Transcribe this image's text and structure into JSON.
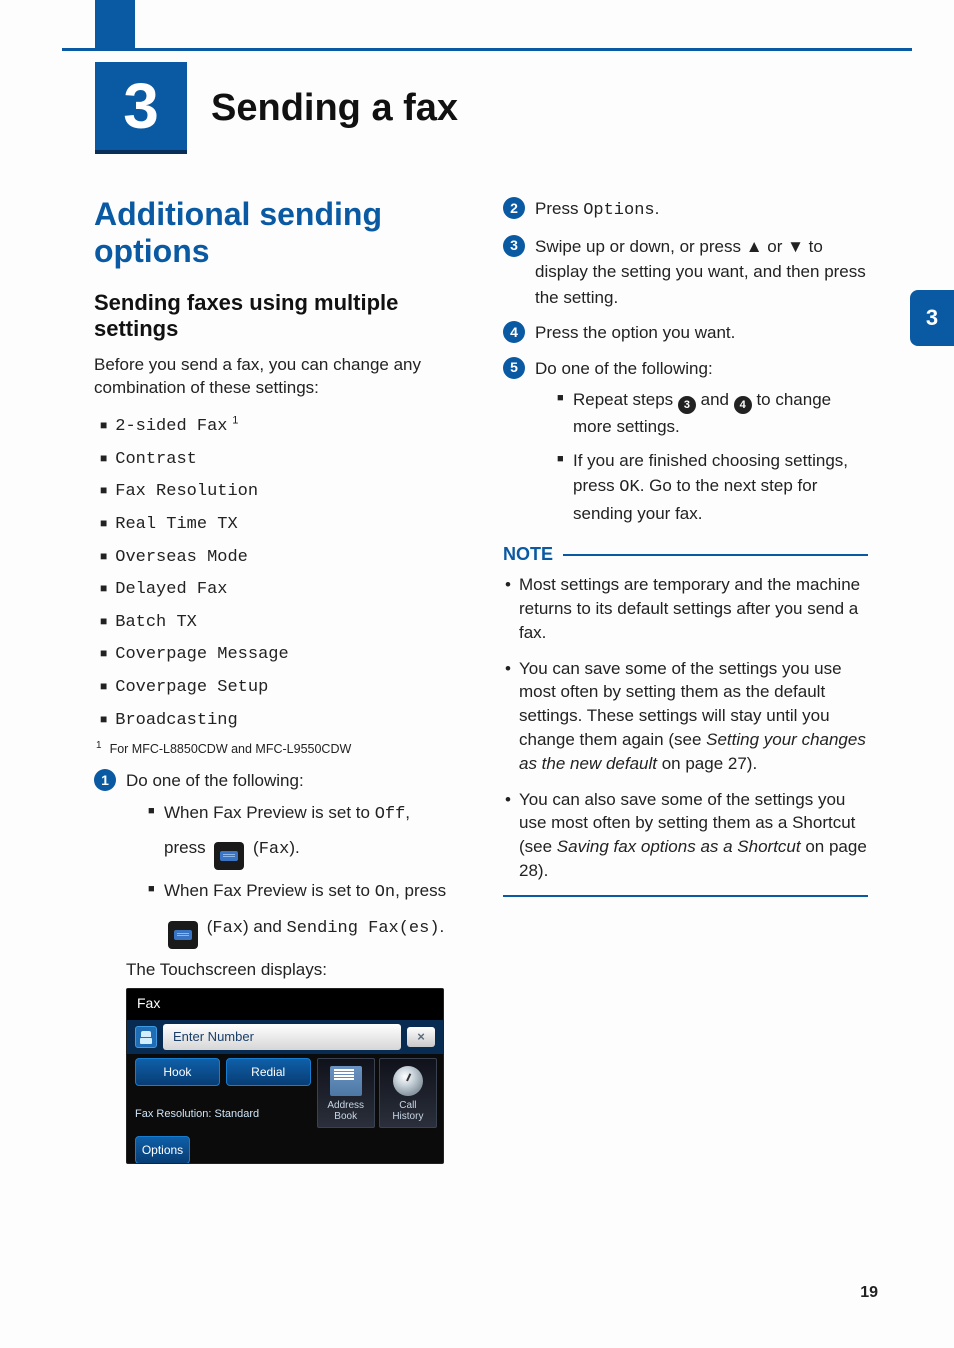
{
  "chapter": {
    "number": "3",
    "title": "Sending a fax",
    "sideTab": "3"
  },
  "left": {
    "h1": "Additional sending options",
    "h2": "Sending faxes using multiple settings",
    "intro": "Before you send a fax, you can change any combination of these settings:",
    "settings": [
      "2-sided Fax",
      "Contrast",
      "Fax Resolution",
      "Real Time TX",
      "Overseas Mode",
      "Delayed Fax",
      "Batch TX",
      "Coverpage Message",
      "Coverpage Setup",
      "Broadcasting"
    ],
    "supMark": "1",
    "footnoteNum": "1",
    "footnote": "For MFC-L8850CDW and MFC-L9550CDW",
    "step1": {
      "num": "1",
      "lead": "Do one of the following:",
      "offA": "When Fax Preview is set to ",
      "offB": "Off",
      "offC": ",",
      "pressLabel": "press ",
      "faxLabelA": "(",
      "faxLabelB": "Fax",
      "faxLabelC": ").",
      "onA": "When Fax Preview is set to ",
      "onB": "On",
      "onC": ", press",
      "andSending": " and ",
      "sendingFaxes": "Sending Fax(es)",
      "period": "."
    },
    "touchscreenCaption": "The Touchscreen displays:",
    "ts": {
      "title": "Fax",
      "enter": "Enter Number",
      "clear": "×",
      "hook": "Hook",
      "redial": "Redial",
      "faxres": "Fax Resolution: Standard",
      "addrbook": "Address Book",
      "callhist": "Call History",
      "options": "Options"
    }
  },
  "right": {
    "step2": {
      "num": "2",
      "a": "Press ",
      "b": "Options",
      "c": "."
    },
    "step3": {
      "num": "3",
      "text": "Swipe up or down, or press ▲ or ▼ to display the setting you want, and then press the setting."
    },
    "step4": {
      "num": "4",
      "text": "Press the option you want."
    },
    "step5": {
      "num": "5",
      "lead": "Do one of the following:",
      "b1a": "Repeat steps ",
      "b1b": " and ",
      "b1c": " to change more settings.",
      "b1n1": "3",
      "b1n2": "4",
      "b2a": "If you are finished choosing settings, press ",
      "b2b": "OK",
      "b2c": ". Go to the next step for sending your fax."
    },
    "noteLabel": "NOTE",
    "notes": {
      "n1": "Most settings are temporary and the machine returns to its default settings after you send a fax.",
      "n2a": "You can save some of the settings you use most often by setting them as the default settings. These settings will stay until you change them again (see ",
      "n2b": "Setting your changes as the new default",
      "n2c": " on page 27).",
      "n3a": "You can also save some of the settings you use most often by setting them as a Shortcut (see ",
      "n3b": "Saving fax options as a Shortcut",
      "n3c": " on page 28)."
    }
  },
  "pageNumber": "19"
}
